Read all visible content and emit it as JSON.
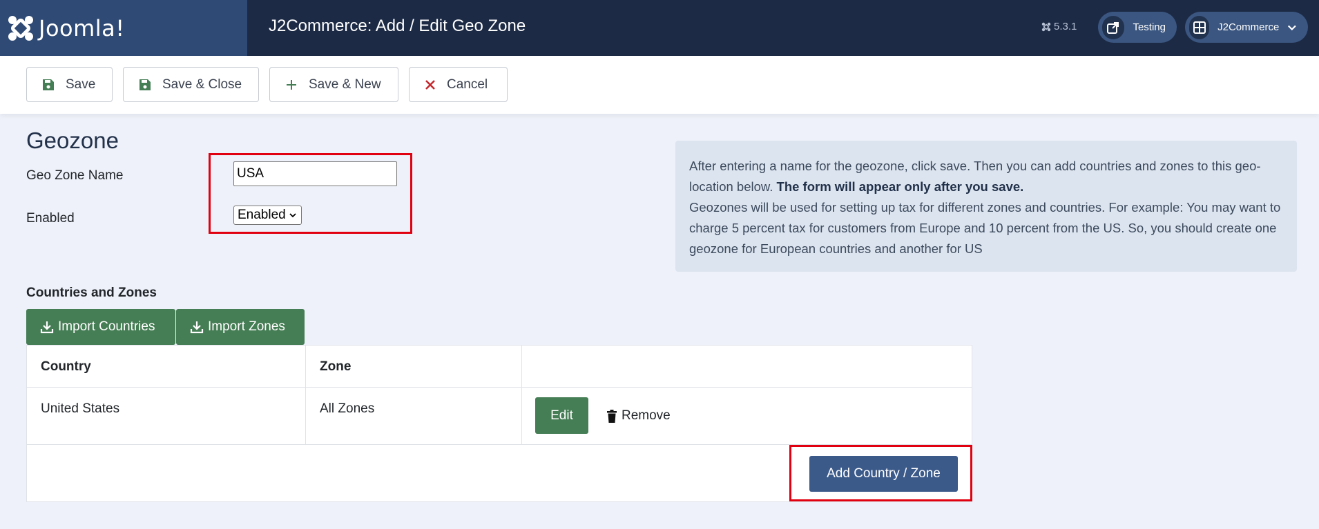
{
  "header": {
    "logo_text": "Joomla!",
    "title": "J2Commerce: Add / Edit Geo Zone",
    "version": "5.3.1",
    "site_link_label": "Testing",
    "user_menu_label": "J2Commerce"
  },
  "toolbar": {
    "save_label": "Save",
    "save_close_label": "Save & Close",
    "save_new_label": "Save & New",
    "cancel_label": "Cancel"
  },
  "form": {
    "section_title": "Geozone",
    "name_label": "Geo Zone Name",
    "name_value": "USA",
    "enabled_label": "Enabled",
    "enabled_value": "Enabled"
  },
  "info": {
    "line1": "After entering a name for the geozone, click save. Then you can add countries and zones to this geo-location below.",
    "line1_bold": "The form will appear only after you save.",
    "line2": "Geozones will be used for setting up tax for different zones and countries. For example: You may want to charge 5 percent tax for customers from Europe and 10 percent from the US. So, you should create one geozone for European countries and another for US"
  },
  "zones": {
    "title": "Countries and Zones",
    "import_countries_label": "Import Countries",
    "import_zones_label": "Import Zones",
    "columns": [
      "Country",
      "Zone",
      ""
    ],
    "rows": [
      {
        "country": "United States",
        "zone": "All Zones"
      }
    ],
    "edit_label": "Edit",
    "remove_label": "Remove",
    "add_label": "Add Country / Zone"
  },
  "colors": {
    "header_bg": "#1c2a45",
    "logo_bg": "#2f4a74",
    "green": "#457d54",
    "primary": "#3b5a8a",
    "highlight": "#e0000f"
  }
}
